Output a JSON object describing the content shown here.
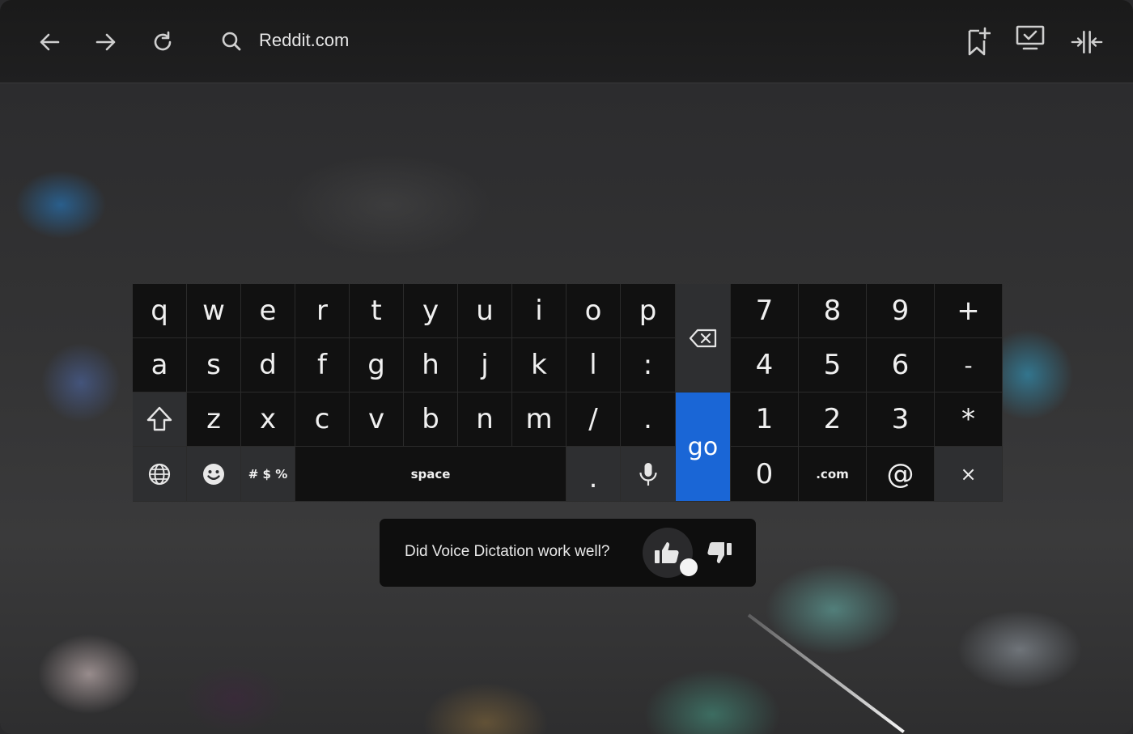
{
  "browser": {
    "url": "Reddit.com",
    "nav": {
      "back_icon": "arrow-left-icon",
      "forward_icon": "arrow-right-icon",
      "reload_icon": "reload-icon"
    },
    "actions": [
      "bookmark-add-icon",
      "screen-cast-icon",
      "split-view-icon"
    ]
  },
  "keyboard": {
    "row1": [
      "q",
      "w",
      "e",
      "r",
      "t",
      "y",
      "u",
      "i",
      "o",
      "p"
    ],
    "row2": [
      "a",
      "s",
      "d",
      "f",
      "g",
      "h",
      "j",
      "k",
      "l",
      ":"
    ],
    "row3": [
      "z",
      "x",
      "c",
      "v",
      "b",
      "n",
      "m",
      "/",
      "."
    ],
    "row4": {
      "symbols": "# $ %",
      "space": "space",
      "period": "."
    },
    "go": "go",
    "numpad": {
      "row1": [
        "7",
        "8",
        "9",
        "+"
      ],
      "row2": [
        "4",
        "5",
        "6",
        "-"
      ],
      "row3": [
        "1",
        "2",
        "3",
        "*"
      ],
      "row4": [
        "0",
        ".com",
        "@",
        "×"
      ]
    },
    "accent_color": "#1a66d6"
  },
  "feedback": {
    "question": "Did Voice Dictation work well?"
  }
}
